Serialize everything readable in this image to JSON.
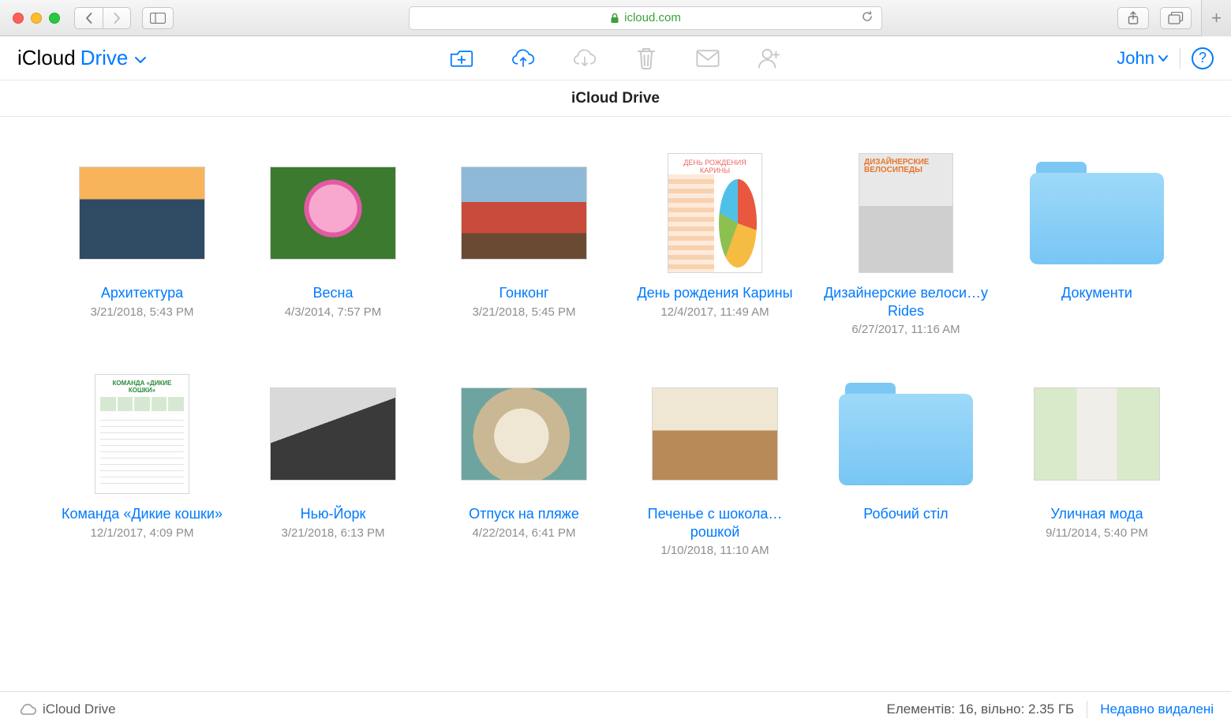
{
  "browser": {
    "url_host": "icloud.com",
    "secure": true
  },
  "app": {
    "brand1": "iCloud",
    "brand2": "Drive",
    "user_name": "John",
    "location_title": "iCloud Drive"
  },
  "status": {
    "breadcrumb": "iCloud Drive",
    "items_label": "Елементів: 16, вільно: 2.35 ГБ",
    "recently_deleted": "Недавно видалені"
  },
  "files": [
    {
      "name": "Архитектура",
      "date": "3/21/2018, 5:43 PM",
      "kind": "landscape",
      "fill": "t-arch"
    },
    {
      "name": "Весна",
      "date": "4/3/2014, 7:57 PM",
      "kind": "landscape",
      "fill": "t-flower"
    },
    {
      "name": "Гонконг",
      "date": "3/21/2018, 5:45 PM",
      "kind": "landscape",
      "fill": "t-hk"
    },
    {
      "name": "День рождения Карины",
      "date": "12/4/2017, 11:49 AM",
      "kind": "portrait",
      "fill": "t-bday",
      "doc_caption": "ДЕНЬ РОЖДЕНИЯ КАРИНЫ"
    },
    {
      "name": "Дизайнерские велоси…у Rides",
      "date": "6/27/2017, 11:16 AM",
      "kind": "portrait",
      "fill": "t-bike",
      "doc_caption": "ДИЗАЙНЕРСКИЕ ВЕЛОСИПЕДЫ"
    },
    {
      "name": "Документи",
      "date": "",
      "kind": "folder"
    },
    {
      "name": "Команда «Дикие кошки»",
      "date": "12/1/2017, 4:09 PM",
      "kind": "portrait",
      "fill": "t-cats",
      "doc_caption": "КОМАНДА «ДИКИЕ КОШКИ»"
    },
    {
      "name": "Нью-Йорк",
      "date": "3/21/2018, 6:13 PM",
      "kind": "landscape",
      "fill": "t-ny"
    },
    {
      "name": "Отпуск на пляже",
      "date": "4/22/2014, 6:41 PM",
      "kind": "landscape",
      "fill": "t-beach"
    },
    {
      "name": "Печенье с шокола…рошкой",
      "date": "1/10/2018, 11:10 AM",
      "kind": "landscape",
      "fill": "t-cookie"
    },
    {
      "name": "Робочий стіл",
      "date": "",
      "kind": "folder"
    },
    {
      "name": "Уличная мода",
      "date": "9/11/2014, 5:40 PM",
      "kind": "landscape",
      "fill": "t-fashion"
    }
  ]
}
